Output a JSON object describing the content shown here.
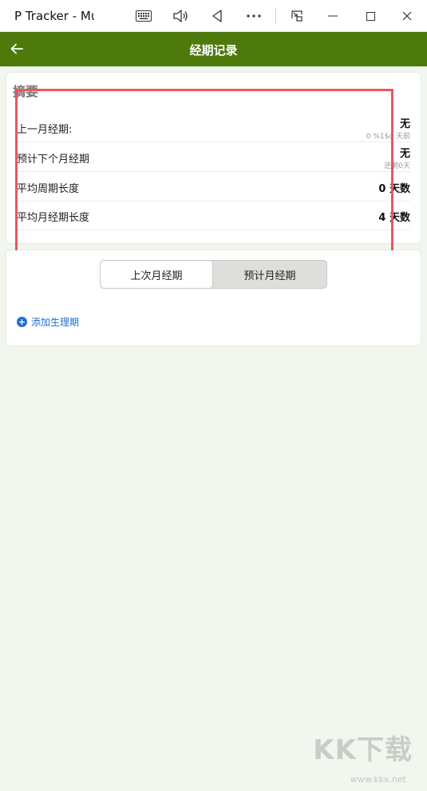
{
  "window": {
    "title": "P Tracker - Mu"
  },
  "appbar": {
    "title": "经期记录"
  },
  "summary": {
    "title": "摘要",
    "rows": [
      {
        "label": "上一月经期:",
        "value": "无",
        "sub": "0 %1$d 天前"
      },
      {
        "label": "预计下个月经期",
        "value": "无",
        "sub": "还剩0天"
      },
      {
        "label": "平均周期长度",
        "value": "0 天数",
        "sub": ""
      },
      {
        "label": "平均月经期长度",
        "value": "4 天数",
        "sub": ""
      }
    ]
  },
  "periods": {
    "tabs": [
      {
        "label": "上次月经期",
        "selected": true
      },
      {
        "label": "预计月经期",
        "selected": false
      }
    ],
    "add_label": "添加生理期"
  },
  "watermark": {
    "text": "KK下载",
    "url": "www.kkx.net"
  },
  "colors": {
    "header": "#4e7a0c",
    "background": "#f1f6ef",
    "highlight": "#e9575f",
    "link": "#1e6fd0"
  }
}
